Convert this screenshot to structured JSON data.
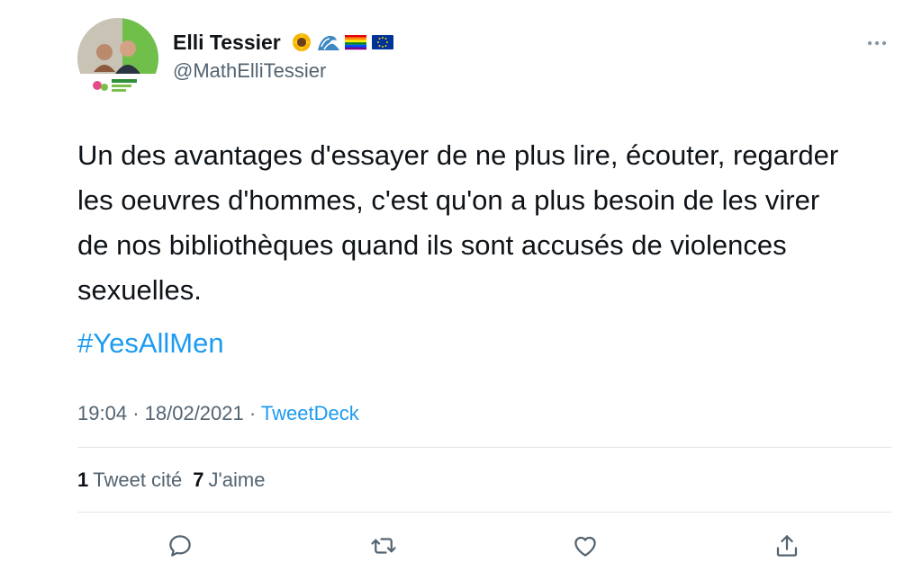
{
  "author": {
    "display_name": "Elli Tessier",
    "handle": "@MathElliTessier",
    "avatar": "profile-photo",
    "emoji_icons": [
      "sunflower-icon",
      "wave-icon",
      "rainbow-flag-icon",
      "eu-flag-icon"
    ]
  },
  "tweet": {
    "text": "Un des avantages d'essayer de ne plus lire, écouter, regarder\nles oeuvres d'hommes, c'est qu'on a plus besoin de les virer\nde nos bibliothèques quand ils sont accusés de violences\nsexuelles.",
    "hashtag": "#YesAllMen",
    "time": "19:04",
    "separator": "·",
    "date": "18/02/2021",
    "source": "TweetDeck"
  },
  "stats": {
    "quote_count": "1",
    "quote_label": "Tweet cité",
    "like_count": "7",
    "like_label": "J'aime"
  },
  "actions": [
    "reply-icon",
    "retweet-icon",
    "like-icon",
    "share-icon"
  ],
  "colors": {
    "link": "#1d9bf0",
    "secondary_text": "#536471",
    "primary_text": "#0f1419",
    "divider": "#e1e6ea"
  }
}
